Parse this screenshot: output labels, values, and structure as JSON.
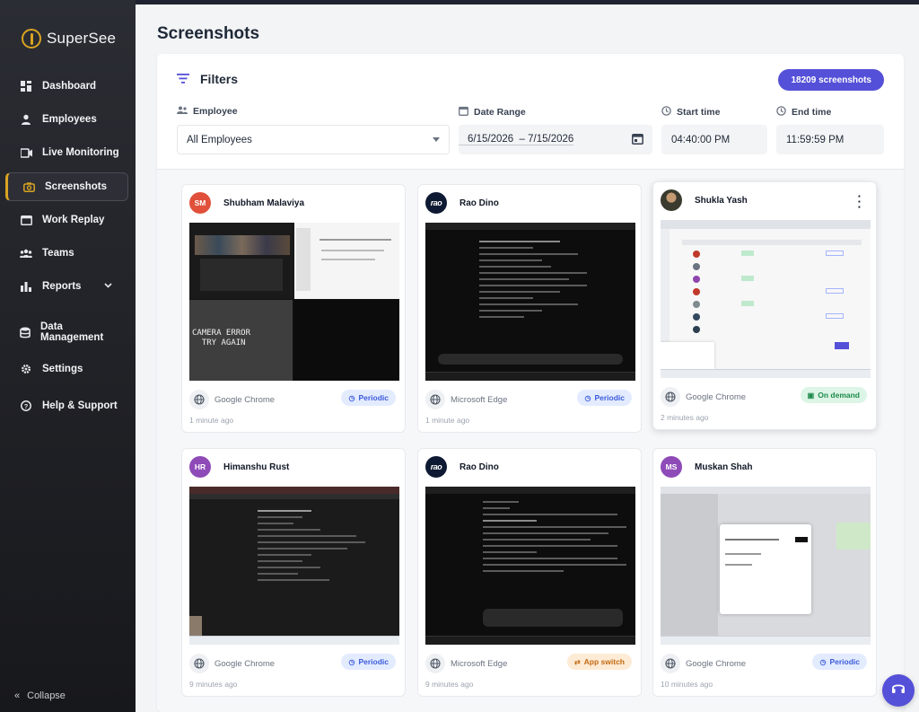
{
  "app": {
    "brand": "SuperSee"
  },
  "sidebar": {
    "items": [
      {
        "label": "Dashboard",
        "icon": "dashboard-icon"
      },
      {
        "label": "Employees",
        "icon": "user-icon"
      },
      {
        "label": "Live Monitoring",
        "icon": "video-icon"
      },
      {
        "label": "Screenshots",
        "icon": "camera-icon",
        "active": true
      },
      {
        "label": "Work Replay",
        "icon": "replay-icon"
      },
      {
        "label": "Teams",
        "icon": "teams-icon"
      },
      {
        "label": "Reports",
        "icon": "bar-chart-icon"
      },
      {
        "label": "Data Management",
        "icon": "database-icon"
      },
      {
        "label": "Settings",
        "icon": "gear-icon"
      },
      {
        "label": "Help & Support",
        "icon": "help-icon"
      }
    ],
    "collapse_label": "Collapse"
  },
  "page": {
    "title": "Screenshots"
  },
  "filters": {
    "title": "Filters",
    "count_badge": "18209 screenshots",
    "employee_label": "Employee",
    "employee_value": "All Employees",
    "date_label": "Date Range",
    "date_value": "6/15/2026  – 7/15/2026",
    "start_label": "Start time",
    "start_value": "04:40:00 PM",
    "end_label": "End time",
    "end_value": "11:59:59 PM"
  },
  "cards": [
    {
      "initials": "SM",
      "name": "Shubham Malaviya",
      "browser": "Google Chrome",
      "tag": "Periodic",
      "ago": "1 minute ago",
      "avatar_color": "#e0503a"
    },
    {
      "initials": "rao",
      "name": "Rao Dino",
      "browser": "Microsoft Edge",
      "tag": "Periodic",
      "ago": "1 minute ago"
    },
    {
      "initials": "",
      "name": "Shukla Yash",
      "browser": "Google Chrome",
      "tag": "On demand",
      "ago": "2 minutes ago"
    },
    {
      "initials": "HR",
      "name": "Himanshu Rust",
      "browser": "Google Chrome",
      "tag": "Periodic",
      "ago": "9 minutes ago",
      "avatar_color": "#8e4bb8"
    },
    {
      "initials": "rao",
      "name": "Rao Dino",
      "browser": "Microsoft Edge",
      "tag": "App switch",
      "ago": "9 minutes ago"
    },
    {
      "initials": "MS",
      "name": "Muskan Shah",
      "browser": "Google Chrome",
      "tag": "Periodic",
      "ago": "10 minutes ago",
      "avatar_color": "#8e4bb8"
    }
  ],
  "shots": {
    "camera_error": "CAMERA ERROR\n  TRY AGAIN"
  },
  "colors": {
    "accent": "#5550d8",
    "sidebar_active": "#d9a422"
  }
}
